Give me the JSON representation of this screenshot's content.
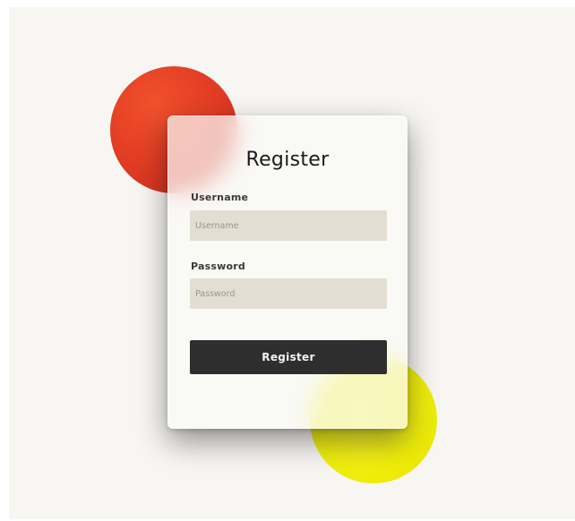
{
  "form": {
    "title": "Register",
    "username": {
      "label": "Username",
      "placeholder": "Username",
      "value": ""
    },
    "password": {
      "label": "Password",
      "placeholder": "Password",
      "value": ""
    },
    "submit_label": "Register"
  },
  "colors": {
    "page_background": "#f8f6f3",
    "card_background": "#faf9f6",
    "input_background": "#e2ddd0",
    "button_background": "#2e2e2e",
    "accent_red": "#e03a24",
    "accent_yellow": "#f0ee0a"
  }
}
